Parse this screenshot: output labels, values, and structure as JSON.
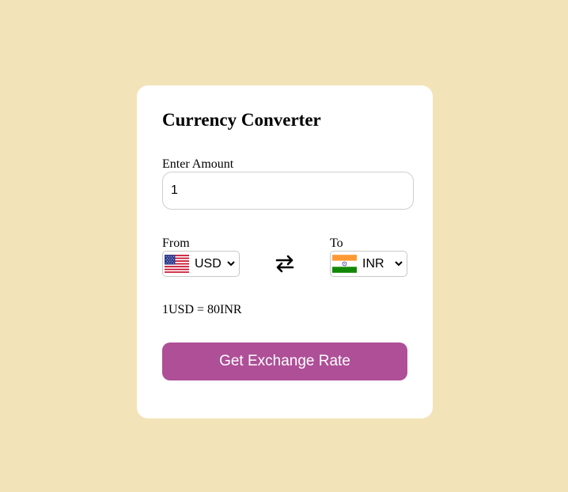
{
  "converter": {
    "title": "Currency Converter",
    "amount_label": "Enter Amount",
    "amount_value": "1",
    "from_label": "From",
    "to_label": "To",
    "from_currency": "USD",
    "to_currency": "INR",
    "from_flag_icon": "us-flag-icon",
    "to_flag_icon": "india-flag-icon",
    "swap_icon": "swap-arrows-icon",
    "rate_text": "1USD = 80INR",
    "button_label": "Get Exchange Rate"
  },
  "colors": {
    "background": "#f3e3b9",
    "card": "#ffffff",
    "button": "#ae4f97",
    "button_text": "#ffffff"
  }
}
